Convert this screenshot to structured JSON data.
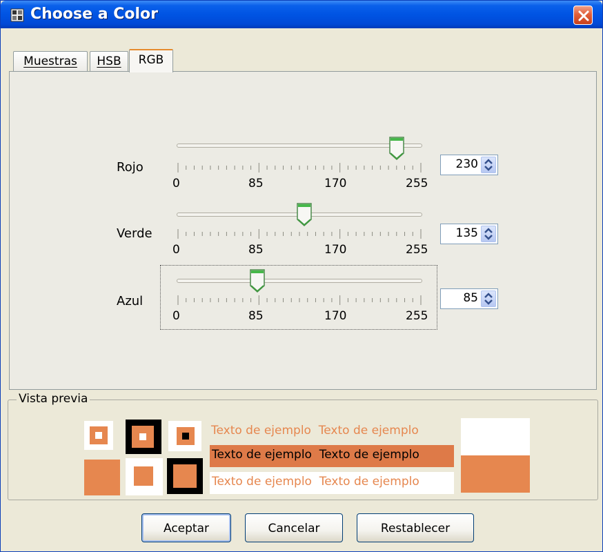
{
  "window": {
    "title": "Choose a Color",
    "title_icon": "color-chooser-icon",
    "close_icon": "close-icon"
  },
  "tabs": [
    {
      "label": "Muestras",
      "active": false
    },
    {
      "label": "HSB",
      "active": false
    },
    {
      "label": "RGB",
      "active": true
    }
  ],
  "sliders": [
    {
      "label": "Rojo",
      "value": "230",
      "min": 0,
      "max": 255
    },
    {
      "label": "Verde",
      "value": "135",
      "min": 0,
      "max": 255
    },
    {
      "label": "Azul",
      "value": "85",
      "min": 0,
      "max": 255
    }
  ],
  "tick_labels": [
    "0",
    "85",
    "170",
    "255"
  ],
  "preview": {
    "legend": "Vista previa",
    "sample_text": "Texto de ejemplo",
    "color": "#e6874f",
    "dark_band": "#de7a48"
  },
  "buttons": {
    "ok": "Aceptar",
    "cancel": "Cancelar",
    "reset": "Restablecer"
  }
}
